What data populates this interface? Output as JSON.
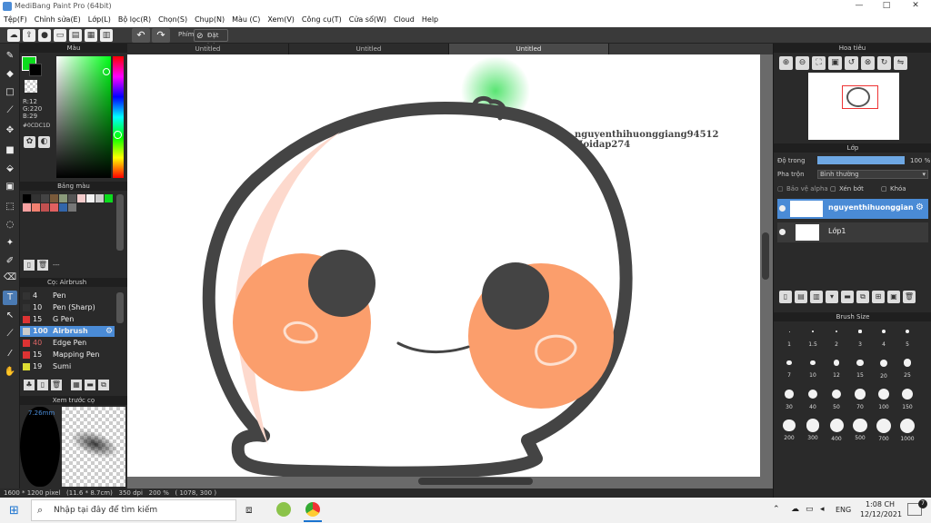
{
  "window": {
    "title": "MediBang Paint Pro (64bit)",
    "controls": [
      "—",
      "□",
      "✕"
    ]
  },
  "menu": [
    "Tệp(F)",
    "Chỉnh sửa(E)",
    "Lớp(L)",
    "Bộ lọc(R)",
    "Chọn(S)",
    "Chụp(N)",
    "Màu (C)",
    "Xem(V)",
    "Công cụ(T)",
    "Cửa sổ(W)",
    "Cloud",
    "Help"
  ],
  "toolbar": {
    "hotkey_label": "Phím",
    "reset_label": "Đặt lại"
  },
  "tabs": [
    "Untitled",
    "Untitled",
    "Untitled"
  ],
  "color_panel": {
    "title": "Màu",
    "r": "R:12",
    "g": "G:220",
    "b": "B:29",
    "hex": "#0CDC1D",
    "fg": "#0cdc1d",
    "bg": "#000000"
  },
  "palette_panel": {
    "title": "Bảng màu",
    "name": "---",
    "swatches": [
      "#000000",
      "#333333",
      "#444444",
      "#7a5a3a",
      "#8a9a7a",
      "#555555",
      "#f4cccc",
      "#f4f4f4",
      "#cccccc",
      "#0cdc1d",
      "#f8a0a0",
      "#f08070",
      "#c05050",
      "#e06060",
      "#3366aa",
      "#777777"
    ]
  },
  "brush_panel": {
    "title": "Cọ: Airbrush",
    "brushes": [
      {
        "size": "4",
        "name": "Pen",
        "color": "#333333"
      },
      {
        "size": "10",
        "name": "Pen (Sharp)",
        "color": "#333333"
      },
      {
        "size": "15",
        "name": "G Pen",
        "color": "#dd3333"
      },
      {
        "size": "100",
        "name": "Airbrush",
        "color": "#cccccc",
        "selected": true
      },
      {
        "size": "40",
        "name": "Edge Pen",
        "color": "#dd3333"
      },
      {
        "size": "15",
        "name": "Mapping Pen",
        "color": "#dd3333"
      },
      {
        "size": "19",
        "name": "Sumi",
        "color": "#dddd33"
      }
    ]
  },
  "preview_panel": {
    "title": "Xem trước cọ",
    "size": "7.26mm"
  },
  "navigator": {
    "title": "Hoa tiêu"
  },
  "layer_panel": {
    "title": "Lớp",
    "opacity_label": "Độ trong",
    "opacity_value": "100 %",
    "blend_label": "Pha trộn",
    "blend_value": "Bình thường",
    "alpha_label": "Bảo vệ alpha",
    "clip_label": "Xén bớt",
    "lock_label": "Khóa",
    "layers": [
      {
        "name": "nguyenthihuonggiang94512"
      },
      {
        "name": "Lớp1"
      }
    ]
  },
  "brush_size": {
    "title": "Brush Size",
    "sizes": [
      "1",
      "1.5",
      "2",
      "3",
      "4",
      "5",
      "7",
      "10",
      "12",
      "15",
      "20",
      "25",
      "30",
      "40",
      "50",
      "70",
      "100",
      "150",
      "200",
      "300",
      "400",
      "500",
      "700",
      "1000"
    ]
  },
  "canvas": {
    "text_line1": "nguyenthihuonggiang94512",
    "text_line2": "Hoidap274"
  },
  "status": {
    "text": "1600 * 1200 pixel   (11.6 * 8.7cm)   350 dpi   200 %   ( 1078, 300 )"
  },
  "taskbar": {
    "search_placeholder": "Nhập tại đây để tìm kiếm",
    "lang": "ENG",
    "time": "1:08 CH",
    "date": "12/12/2021",
    "notif": "7"
  }
}
